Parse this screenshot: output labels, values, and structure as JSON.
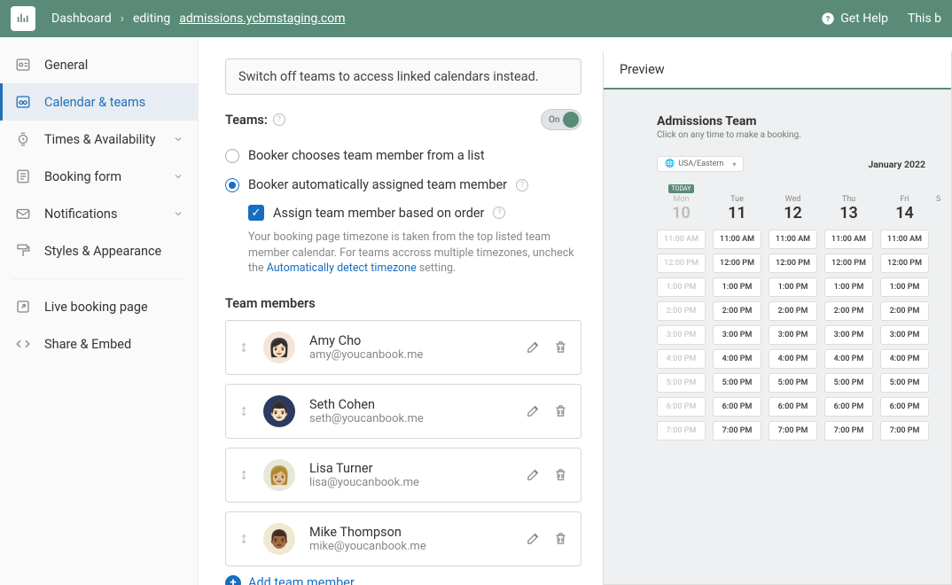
{
  "topbar": {
    "dashboard": "Dashboard",
    "editing": "editing",
    "url": "admissions.ycbmstaging.com",
    "get_help": "Get Help",
    "this_b": "This b"
  },
  "sidebar": {
    "items": [
      {
        "label": "General",
        "icon": "general"
      },
      {
        "label": "Calendar & teams",
        "icon": "calendar"
      },
      {
        "label": "Times & Availability",
        "icon": "times",
        "expandable": true
      },
      {
        "label": "Booking form",
        "icon": "form",
        "expandable": true
      },
      {
        "label": "Notifications",
        "icon": "notifications",
        "expandable": true
      },
      {
        "label": "Styles & Appearance",
        "icon": "styles"
      }
    ],
    "bottom": [
      {
        "label": "Live booking page",
        "icon": "external"
      },
      {
        "label": "Share & Embed",
        "icon": "code"
      }
    ]
  },
  "main": {
    "notice": "Switch off teams to access linked calendars instead.",
    "teams_label": "Teams:",
    "toggle": {
      "label": "On",
      "on": true
    },
    "radio1": "Booker chooses team member from a list",
    "radio2": "Booker automatically assigned team member",
    "checkbox": "Assign team member based on order",
    "helper_pre": "Your booking page timezone is taken from the top listed team member calendar. For teams accross multiple timezones, uncheck the ",
    "helper_link": "Automatically detect timezone",
    "helper_post": " setting.",
    "members_title": "Team members",
    "members": [
      {
        "name": "Amy Cho",
        "email": "amy@youcanbook.me",
        "bg": "#f3e6d8"
      },
      {
        "name": "Seth Cohen",
        "email": "seth@youcanbook.me",
        "bg": "#2a3b5f"
      },
      {
        "name": "Lisa Turner",
        "email": "lisa@youcanbook.me",
        "bg": "#e8e8d8"
      },
      {
        "name": "Mike Thompson",
        "email": "mike@youcanbook.me",
        "bg": "#f0e8d0"
      }
    ],
    "add_member": "Add team member"
  },
  "preview": {
    "header": "Preview",
    "title": "Admissions Team",
    "subtitle": "Click on any time to make a booking.",
    "timezone": "USA/Eastern",
    "month": "January 2022",
    "today_label": "TODAY",
    "days": [
      {
        "dow": "Mon",
        "num": "10",
        "past": true,
        "today": true
      },
      {
        "dow": "Tue",
        "num": "11"
      },
      {
        "dow": "Wed",
        "num": "12"
      },
      {
        "dow": "Thu",
        "num": "13"
      },
      {
        "dow": "Fri",
        "num": "14"
      },
      {
        "dow": "S",
        "num": ""
      }
    ],
    "times": [
      "11:00 AM",
      "12:00 PM",
      "1:00 PM",
      "2:00 PM",
      "3:00 PM",
      "4:00 PM",
      "5:00 PM",
      "6:00 PM",
      "7:00 PM"
    ]
  }
}
